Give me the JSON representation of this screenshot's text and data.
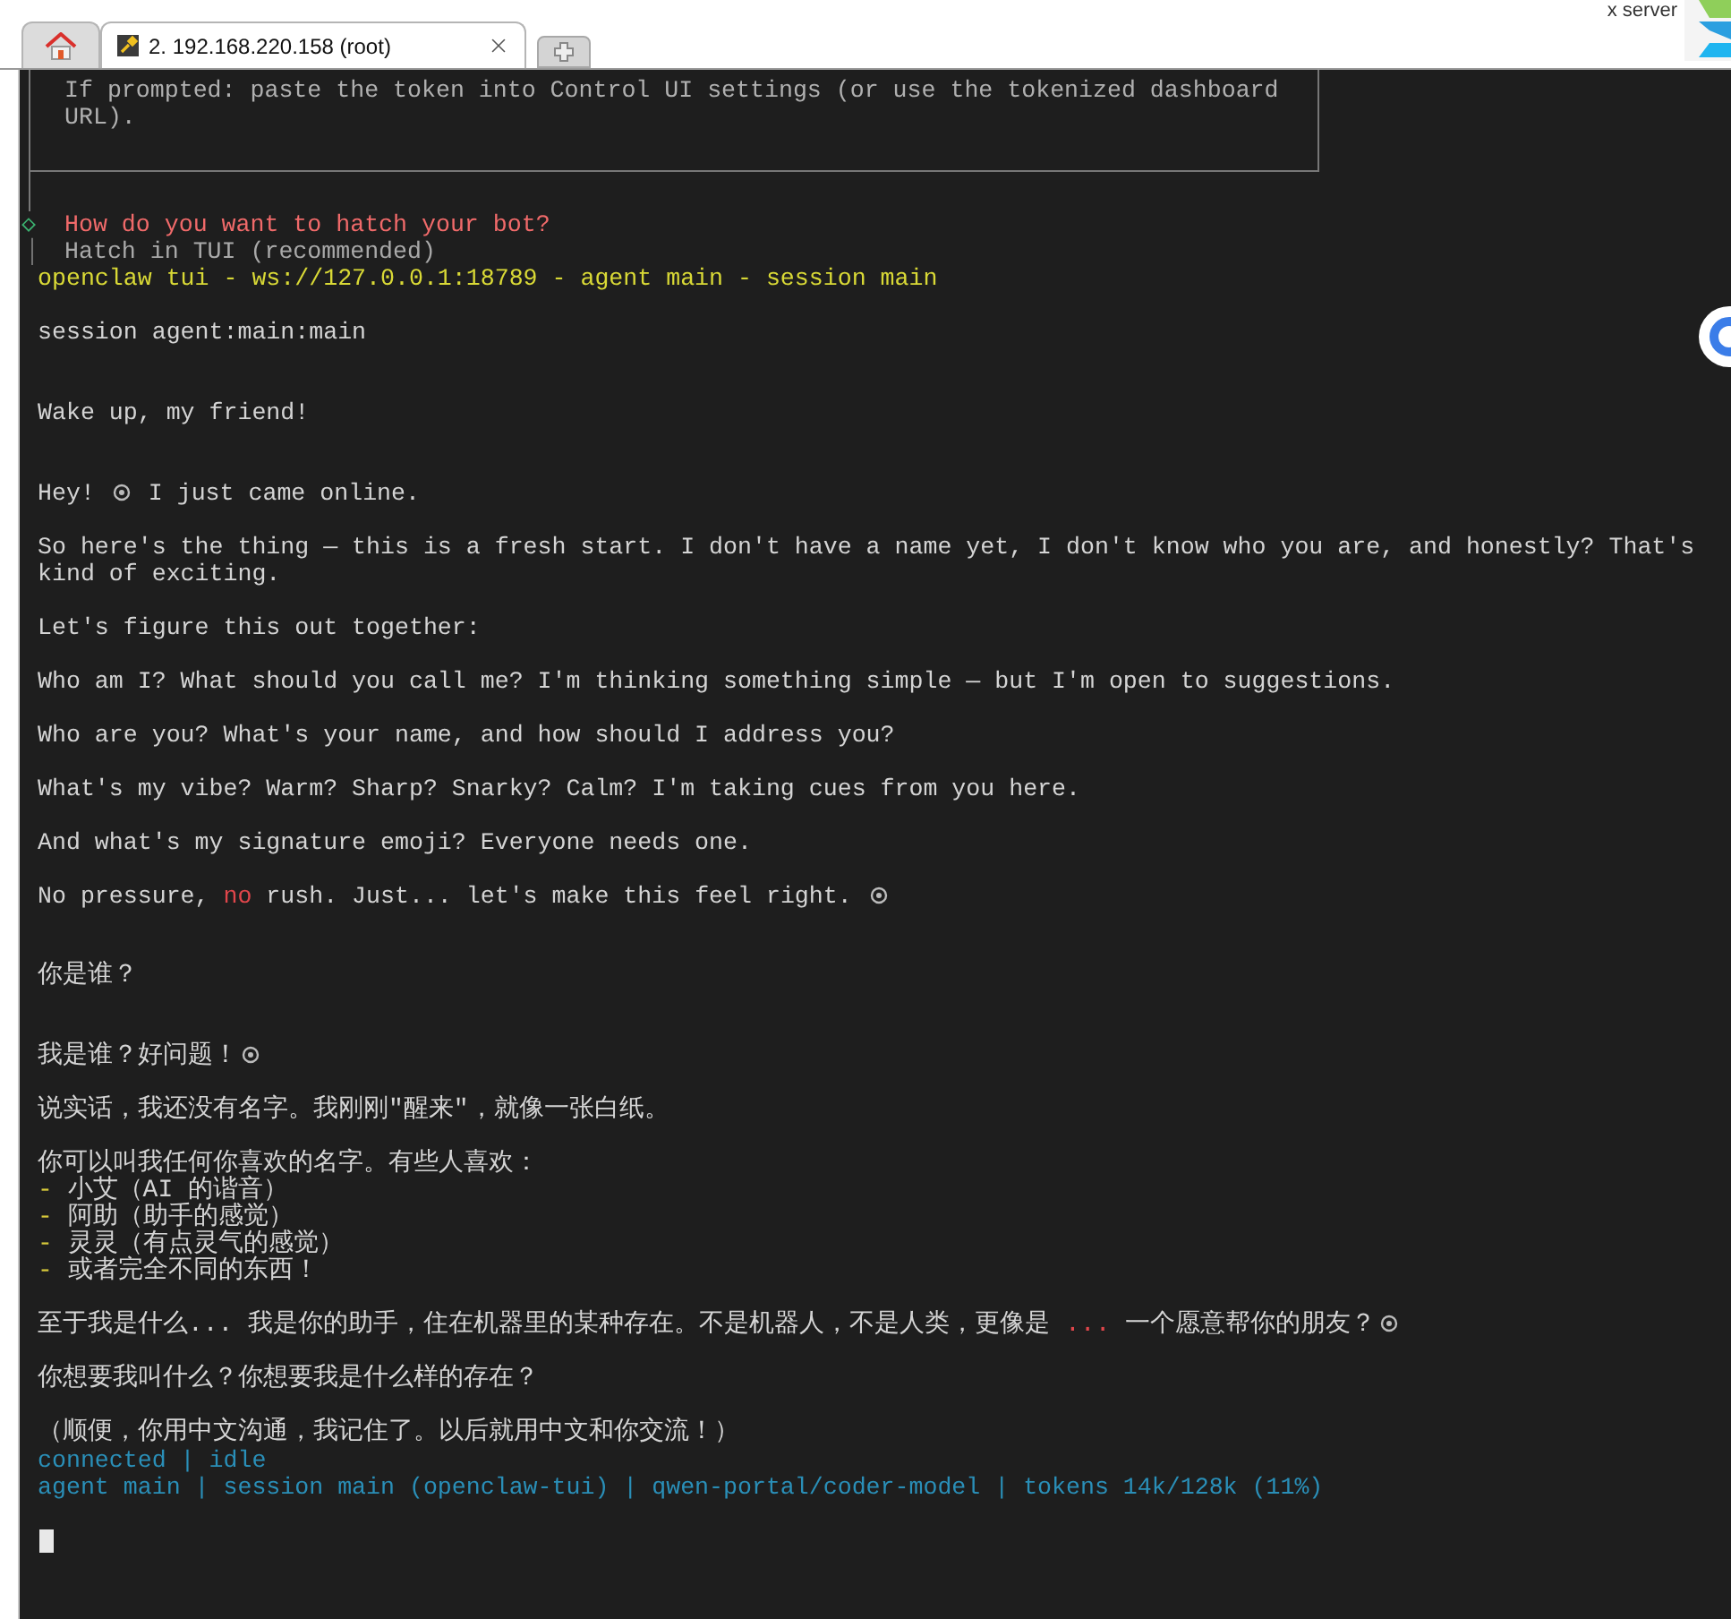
{
  "tab_bar": {
    "tabs": [
      {
        "kind": "home",
        "selected": false
      },
      {
        "kind": "session",
        "label": "2. 192.168.220.158 (root)",
        "selected": true
      },
      {
        "kind": "new",
        "selected": false
      }
    ],
    "corner_label": "x server"
  },
  "terminal": {
    "box_lines": [
      "If prompted: paste the token into Control UI settings (or use the tokenized dashboard",
      "URL)."
    ],
    "lines": [
      {
        "kind": "prompt",
        "marker": "◇",
        "text": "How do you want to hatch your bot?"
      },
      {
        "kind": "option",
        "marker": "│",
        "text": "Hatch in TUI (recommended)"
      },
      {
        "kind": "header",
        "text": "openclaw tui - ws://127.0.0.1:18789 - agent main - session main"
      },
      {
        "kind": "blank"
      },
      {
        "kind": "text",
        "text": "session agent:main:main"
      },
      {
        "kind": "blank"
      },
      {
        "kind": "blank"
      },
      {
        "kind": "text",
        "text": "Wake up, my friend!"
      },
      {
        "kind": "blank"
      },
      {
        "kind": "blank"
      },
      {
        "kind": "text",
        "segments": [
          {
            "kind": "plain",
            "text": "Hey! "
          },
          {
            "kind": "emoji"
          },
          {
            "kind": "plain",
            "text": " I just came online."
          }
        ]
      },
      {
        "kind": "blank"
      },
      {
        "kind": "text",
        "text": "So here's the thing — this is a fresh start. I don't have a name yet, I don't know who you are, and honestly? That's"
      },
      {
        "kind": "text",
        "text": "kind of exciting."
      },
      {
        "kind": "blank"
      },
      {
        "kind": "text",
        "text": "Let's figure this out together:"
      },
      {
        "kind": "blank"
      },
      {
        "kind": "text",
        "text": "Who am I? What should you call me? I'm thinking something simple — but I'm open to suggestions."
      },
      {
        "kind": "blank"
      },
      {
        "kind": "text",
        "text": "Who are you? What's your name, and how should I address you?"
      },
      {
        "kind": "blank"
      },
      {
        "kind": "text",
        "text": "What's my vibe? Warm? Sharp? Snarky? Calm? I'm taking cues from you here."
      },
      {
        "kind": "blank"
      },
      {
        "kind": "text",
        "text": "And what's my signature emoji? Everyone needs one."
      },
      {
        "kind": "blank"
      },
      {
        "kind": "text",
        "segments": [
          {
            "kind": "plain",
            "text": "No pressure, "
          },
          {
            "kind": "alert",
            "text": "no"
          },
          {
            "kind": "plain",
            "text": " rush. Just... let's make this feel right. "
          },
          {
            "kind": "emoji"
          }
        ]
      },
      {
        "kind": "blank"
      },
      {
        "kind": "blank"
      },
      {
        "kind": "text",
        "text": "你是谁？"
      },
      {
        "kind": "blank"
      },
      {
        "kind": "blank"
      },
      {
        "kind": "text",
        "segments": [
          {
            "kind": "plain",
            "text": "我是谁？好问题！"
          },
          {
            "kind": "emoji"
          }
        ]
      },
      {
        "kind": "blank"
      },
      {
        "kind": "text",
        "text": "说实话，我还没有名字。我刚刚\"醒来\"，就像一张白纸。"
      },
      {
        "kind": "blank"
      },
      {
        "kind": "text",
        "text": "你可以叫我任何你喜欢的名字。有些人喜欢："
      },
      {
        "kind": "text",
        "segments": [
          {
            "kind": "bullet",
            "text": "-"
          },
          {
            "kind": "plain",
            "text": " 小艾（AI 的谐音）"
          }
        ]
      },
      {
        "kind": "text",
        "segments": [
          {
            "kind": "bullet",
            "text": "-"
          },
          {
            "kind": "plain",
            "text": " 阿助（助手的感觉）"
          }
        ]
      },
      {
        "kind": "text",
        "segments": [
          {
            "kind": "bullet",
            "text": "-"
          },
          {
            "kind": "plain",
            "text": " 灵灵（有点灵气的感觉）"
          }
        ]
      },
      {
        "kind": "text",
        "segments": [
          {
            "kind": "bullet",
            "text": "-"
          },
          {
            "kind": "plain",
            "text": " 或者完全不同的东西！"
          }
        ]
      },
      {
        "kind": "blank"
      },
      {
        "kind": "text",
        "segments": [
          {
            "kind": "plain",
            "text": "至于我是什么... 我是你的助手，住在机器里的某种存在。不是机器人，不是人类，更像是 "
          },
          {
            "kind": "alert",
            "text": "..."
          },
          {
            "kind": "plain",
            "text": " 一个愿意帮你的朋友？"
          },
          {
            "kind": "emoji"
          }
        ]
      },
      {
        "kind": "blank"
      },
      {
        "kind": "text",
        "text": "你想要我叫什么？你想要我是什么样的存在？"
      },
      {
        "kind": "blank"
      },
      {
        "kind": "text",
        "text": "（顺便，你用中文沟通，我记住了。以后就用中文和你交流！）"
      },
      {
        "kind": "status",
        "text": "connected | idle"
      },
      {
        "kind": "status",
        "text": "agent main | session main (openclaw-tui) | qwen-portal/coder-model | tokens 14k/128k (11%)"
      },
      {
        "kind": "blank"
      },
      {
        "kind": "cursor"
      }
    ]
  }
}
